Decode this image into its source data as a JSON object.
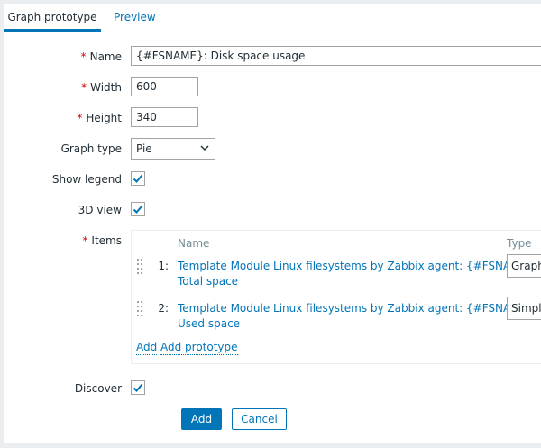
{
  "tabs": [
    {
      "label": "Graph prototype",
      "active": true
    },
    {
      "label": "Preview",
      "active": false
    }
  ],
  "form": {
    "required_mark": "*",
    "name": {
      "label": "Name",
      "value": "{#FSNAME}: Disk space usage"
    },
    "width": {
      "label": "Width",
      "value": "600"
    },
    "height": {
      "label": "Height",
      "value": "340"
    },
    "graph_type": {
      "label": "Graph type",
      "value": "Pie"
    },
    "show_legend": {
      "label": "Show legend",
      "checked": true
    },
    "view_3d": {
      "label": "3D view",
      "checked": true
    },
    "items": {
      "label": "Items",
      "col_name": "Name",
      "col_type": "Type",
      "rows": [
        {
          "num": "1:",
          "line1": "Template Module Linux filesystems by Zabbix agent: {#FSNAME}:",
          "line2": "Total space",
          "type": "Graph sum"
        },
        {
          "num": "2:",
          "line1": "Template Module Linux filesystems by Zabbix agent: {#FSNAME}:",
          "line2": "Used space",
          "type": "Simple"
        }
      ],
      "add_label": "Add",
      "add_prototype_label": "Add prototype"
    },
    "discover": {
      "label": "Discover",
      "checked": true
    }
  },
  "buttons": {
    "add": "Add",
    "cancel": "Cancel"
  },
  "colors": {
    "accent": "#0275b8",
    "required": "#d40000",
    "background": "#ebeef0"
  }
}
